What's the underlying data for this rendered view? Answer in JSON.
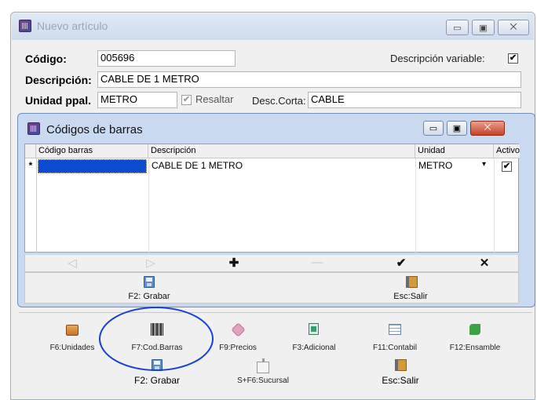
{
  "window": {
    "title": "Nuevo artículo",
    "caption_buttons": {
      "minimize": "▭",
      "maximize": "▣",
      "close": "⨉"
    }
  },
  "form": {
    "codigo_label": "Código:",
    "codigo_value": "005696",
    "descripcion_variable_label": "Descripción variable:",
    "descripcion_variable_checked": "✔",
    "descripcion_label": "Descripción:",
    "descripcion_value": "CABLE DE 1 METRO",
    "unidad_label": "Unidad ppal.",
    "unidad_value": "METRO",
    "resaltar_label": "Resaltar",
    "resaltar_checked": "✔",
    "desc_corta_label": "Desc.Corta:",
    "desc_corta_value": "CABLE"
  },
  "barcode_dialog": {
    "title": "Códigos de barras",
    "columns": [
      "Código barras",
      "Descripción",
      "Unidad",
      "Activo"
    ],
    "rows": [
      {
        "marker": "*",
        "codigo": "",
        "descripcion": "CABLE DE 1 METRO",
        "unidad": "METRO",
        "activo": "✔"
      }
    ],
    "unidad_dropdown_arrow": "▾",
    "nav": {
      "first": "◁",
      "prior": "▷",
      "insert": "✚",
      "delete": "—",
      "post": "✔",
      "cancel": "✕"
    },
    "footer": {
      "save_label": "F2: Grabar",
      "exit_label": "Esc:Salir"
    }
  },
  "toolbar": {
    "items": [
      {
        "label": "F6:Unidades",
        "icon": "box-icon"
      },
      {
        "label": "F7:Cod.Barras",
        "icon": "barcode-icon"
      },
      {
        "label": "F9:Precios",
        "icon": "tag-icon"
      },
      {
        "label": "F3:Adicional",
        "icon": "document-icon"
      },
      {
        "label": "F11:Contabil",
        "icon": "table-icon"
      },
      {
        "label": "F12:Ensamble",
        "icon": "puzzle-icon"
      }
    ],
    "save_label": "F2: Grabar",
    "branch_label": "S+F6:Sucursal",
    "exit_label": "Esc:Salir"
  },
  "colors": {
    "highlight_ellipse": "#1a3fd6",
    "selected_cell": "#0a4bd1",
    "dialog_frame": "#c9daf0"
  }
}
